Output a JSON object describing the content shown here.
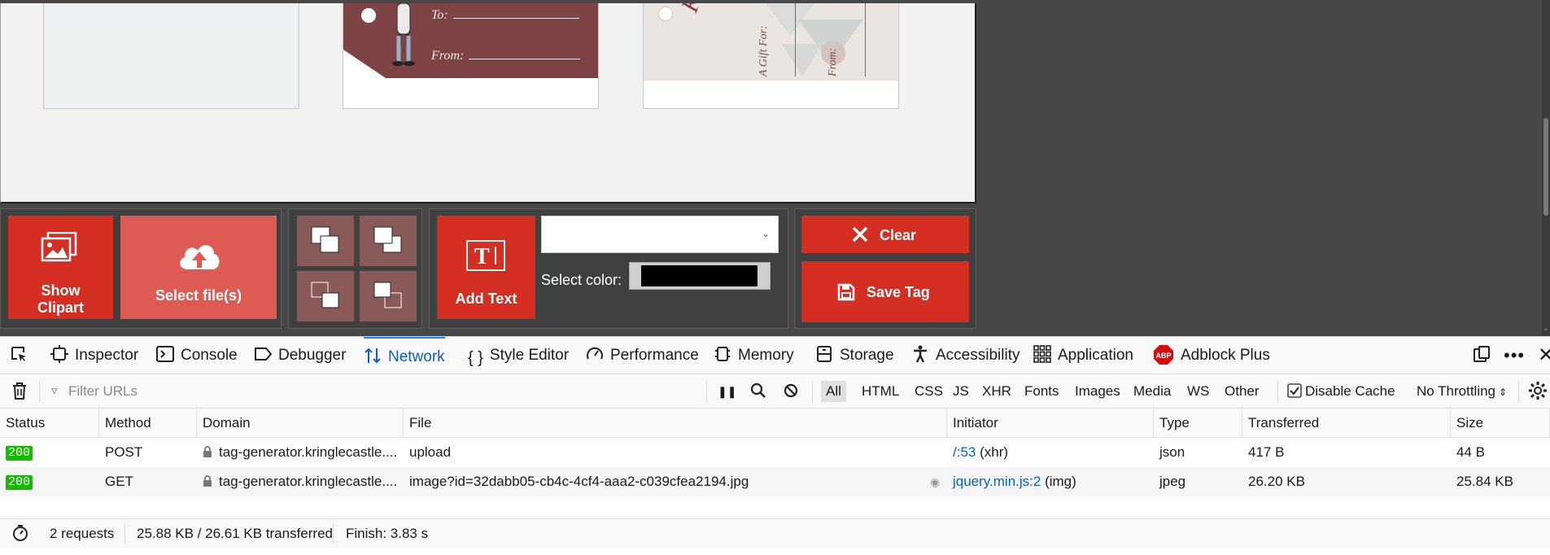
{
  "toolbar": {
    "show_clipart": [
      "Show",
      "Clipart"
    ],
    "select_files": "Select file(s)",
    "add_text": "Add Text",
    "select_color_label": "Select color:",
    "clear": "Clear",
    "save_tag": "Save Tag",
    "color_select_value": "",
    "color_value": "#000000"
  },
  "tags": {
    "tag2": {
      "to": "To:",
      "from": "From:"
    },
    "tag3": {
      "script": "Kring",
      "gift_for": "A Gift For:",
      "from": "From:"
    }
  },
  "devtools": {
    "tabs": [
      {
        "label": "Inspector",
        "icon": "inspector-icon"
      },
      {
        "label": "Console",
        "icon": "console-icon"
      },
      {
        "label": "Debugger",
        "icon": "debugger-icon"
      },
      {
        "label": "Network",
        "icon": "network-icon",
        "active": true
      },
      {
        "label": "Style Editor",
        "icon": "braces-icon"
      },
      {
        "label": "Performance",
        "icon": "gauge-icon"
      },
      {
        "label": "Memory",
        "icon": "memory-icon"
      },
      {
        "label": "Storage",
        "icon": "storage-icon"
      },
      {
        "label": "Accessibility",
        "icon": "accessibility-icon"
      },
      {
        "label": "Application",
        "icon": "grid-icon"
      },
      {
        "label": "Adblock Plus",
        "icon": "abp-icon"
      }
    ],
    "abp_badge": "ABP",
    "filter_placeholder": "Filter URLs",
    "type_filters": [
      "All",
      "HTML",
      "CSS",
      "JS",
      "XHR",
      "Fonts",
      "Images",
      "Media",
      "WS",
      "Other"
    ],
    "disable_cache_label": "Disable Cache",
    "disable_cache_checked": true,
    "throttling": "No Throttling",
    "columns": [
      "Status",
      "Method",
      "Domain",
      "File",
      "Initiator",
      "Type",
      "Transferred",
      "Size"
    ],
    "rows": [
      {
        "status": "200",
        "method": "POST",
        "domain": "tag-generator.kringlecastle....",
        "file": "upload",
        "initiator_link": "/:53",
        "initiator_note": "(xhr)",
        "type": "json",
        "transferred": "417 B",
        "size": "44 B"
      },
      {
        "status": "200",
        "method": "GET",
        "domain": "tag-generator.kringlecastle....",
        "file": "image?id=32dabb05-cb4c-4cf4-aaa2-c039cfea2194.jpg",
        "initiator_link": "jquery.min.js:2",
        "initiator_note": "(img)",
        "type": "jpeg",
        "transferred": "26.20 KB",
        "size": "25.84 KB"
      }
    ],
    "summary": {
      "requests": "2 requests",
      "transferred": "25.88 KB / 26.61 KB transferred",
      "finish": "Finish: 3.83 s"
    },
    "colors": {
      "accent": "#0a84ff",
      "status_ok": "#12bc00",
      "tool_red": "#d42f22"
    }
  }
}
